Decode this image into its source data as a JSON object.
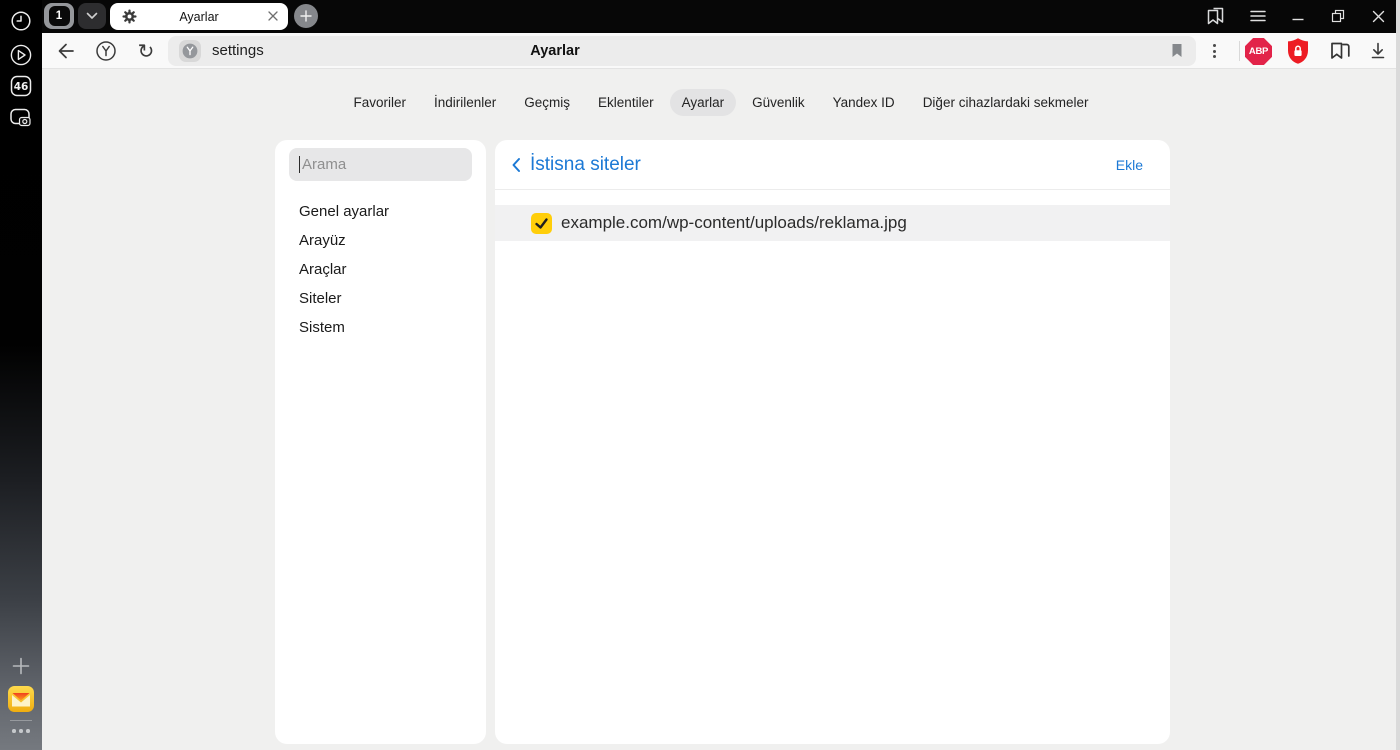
{
  "titlebar": {
    "tab_counter": "1",
    "active_tab_title": "Ayarlar"
  },
  "browser_toolbar": {
    "url": "settings",
    "page_title": "Ayarlar",
    "adblock_label": "ABP"
  },
  "app_sidebar": {
    "extension_badge": "46"
  },
  "settings_nav": {
    "tabs": [
      {
        "label": "Favoriler",
        "active": false
      },
      {
        "label": "İndirilenler",
        "active": false
      },
      {
        "label": "Geçmiş",
        "active": false
      },
      {
        "label": "Eklentiler",
        "active": false
      },
      {
        "label": "Ayarlar",
        "active": true
      },
      {
        "label": "Güvenlik",
        "active": false
      },
      {
        "label": "Yandex ID",
        "active": false
      },
      {
        "label": "Diğer cihazlardaki sekmeler",
        "active": false
      }
    ]
  },
  "settings_panel": {
    "search_placeholder": "Arama",
    "menu": [
      "Genel ayarlar",
      "Arayüz",
      "Araçlar",
      "Siteler",
      "Sistem"
    ]
  },
  "exceptions_panel": {
    "title": "İstisna siteler",
    "add_button": "Ekle",
    "items": [
      {
        "url": "example.com/wp-content/uploads/reklama.jpg",
        "checked": true
      }
    ]
  },
  "icons": {
    "history-clock-icon": "clock outline in circle",
    "player-icon": "play triangle in circle",
    "extensions-badge-icon": "rounded square with count",
    "screenshot-icon": "frame with camera",
    "add-panel-icon": "plus",
    "yandex-mail-icon": "yellow envelope tile",
    "more-dots-icon": "•••",
    "chevron-down-icon": "˅",
    "gear-icon": "⚙",
    "close-icon": "×",
    "new-tab-icon": "+",
    "side-panel-icon": "double bookmark",
    "menu-icon": "≡",
    "minimize-icon": "_",
    "restore-icon": "❐",
    "back-icon": "←",
    "yandex-button-icon": "Y in circle",
    "refresh-icon": "↻",
    "site-favicon": "Y badge",
    "bookmark-icon": "filled flag",
    "kebab-icon": "⋮",
    "adblock-badge-icon": "ABP octagon",
    "protect-shield-icon": "red shield with lock",
    "collections-icon": "flag with page",
    "download-icon": "↓ with bar",
    "back-chevron-icon": "‹",
    "check-icon": "✓"
  },
  "colors": {
    "accent_blue": "#1c79d5",
    "checkbox_yellow": "#ffce0a",
    "adblock_red": "#e22349",
    "shield_red": "#ed1c24",
    "titlebar_black": "#070707"
  }
}
